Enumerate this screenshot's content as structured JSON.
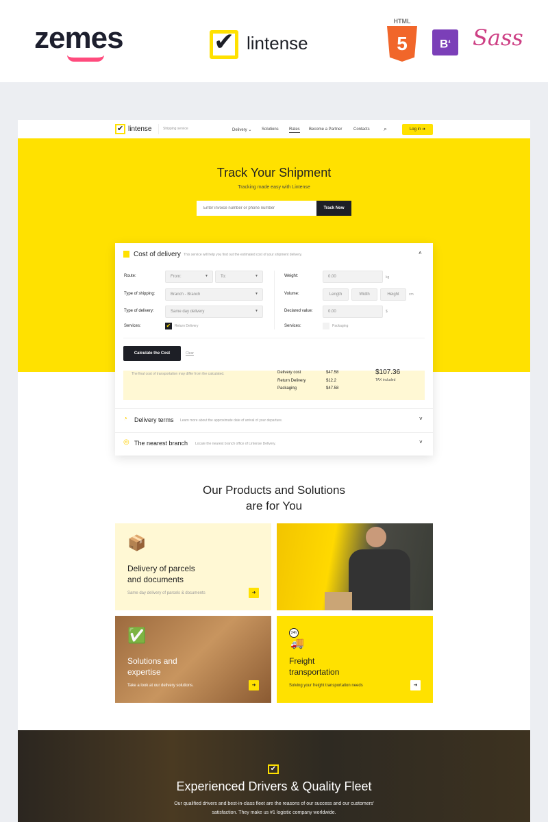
{
  "banner": {
    "zemes_logo": "zemes",
    "lintense_logo": "lintense",
    "html_badge": "HTML",
    "html_number": "5",
    "bootstrap_badge": "B",
    "bootstrap_version": "4",
    "sass_badge": "Sass"
  },
  "nav": {
    "logo": "lintense",
    "tagline": "Shipping service",
    "items": [
      "Delivery",
      "Solutions",
      "Rates",
      "Become a Partner",
      "Contacts"
    ],
    "active": "Rates",
    "login": "Log in"
  },
  "hero": {
    "title": "Track Your Shipment",
    "subtitle": "Tracking made easy with Lintense",
    "placeholder": "Enter invoice number or phone number",
    "button": "Track Now"
  },
  "cost": {
    "title": "Cost of delivery",
    "desc": "This service will help you find out the estimated cost of your shipment delivery.",
    "route_label": "Route:",
    "from": "From:",
    "to": "To:",
    "shipping_label": "Type of shipping:",
    "shipping_value": "Branch - Branch",
    "delivery_label": "Type of delivery:",
    "delivery_value": "Same day delivery",
    "services_label": "Services:",
    "service_left": "Return Delivery",
    "service_left_checked": true,
    "weight_label": "Weight:",
    "weight_value": "0.00",
    "weight_unit": "kg",
    "volume_label": "Volume:",
    "length": "Length",
    "width": "Width",
    "height": "Height",
    "volume_unit": "cm",
    "declared_label": "Declared value:",
    "declared_value": "0.00",
    "declared_unit": "$",
    "service_right": "Packaging",
    "service_right_checked": false,
    "calculate": "Calculate the Cost",
    "clear": "Clear",
    "note": "The final cost of transportation may differ from the calculated.",
    "lines": [
      {
        "name": "Delivery cost",
        "value": "$47.58"
      },
      {
        "name": "Return Delivery",
        "value": "$12.2"
      },
      {
        "name": "Packaging",
        "value": "$47.58"
      }
    ],
    "total": "$107.36",
    "tax": "TAX included"
  },
  "terms": {
    "title": "Delivery terms",
    "desc": "Learn more about the approximate date of arrival of your departure."
  },
  "branch": {
    "title": "The nearest branch",
    "desc": "Locate the nearest branch office of Lintense Delivery."
  },
  "products": {
    "title_line1": "Our Products and Solutions",
    "title_line2": "are for You",
    "cards": [
      {
        "l1": "Delivery of parcels",
        "l2": "and documents",
        "desc": "Same day delivery of parcels & documents"
      },
      {
        "l1": "Solutions and",
        "l2": "expertise",
        "desc": "Take a look at our delivery solutions."
      },
      {
        "l1": "Freight",
        "l2": "transportation",
        "desc": "Solving your freight transportation needs",
        "badge": "24h"
      }
    ]
  },
  "fleet": {
    "title": "Experienced Drivers & Quality Fleet",
    "text1": "Our qualified drivers and best-in-class fleet are the reasons of our success and our customers'",
    "text2": "satisfaction. They make us #1 logistic company worldwide."
  },
  "colors": {
    "accent": "#ffe100",
    "dark": "#1d1f26",
    "light_yellow": "#fff8d4"
  }
}
